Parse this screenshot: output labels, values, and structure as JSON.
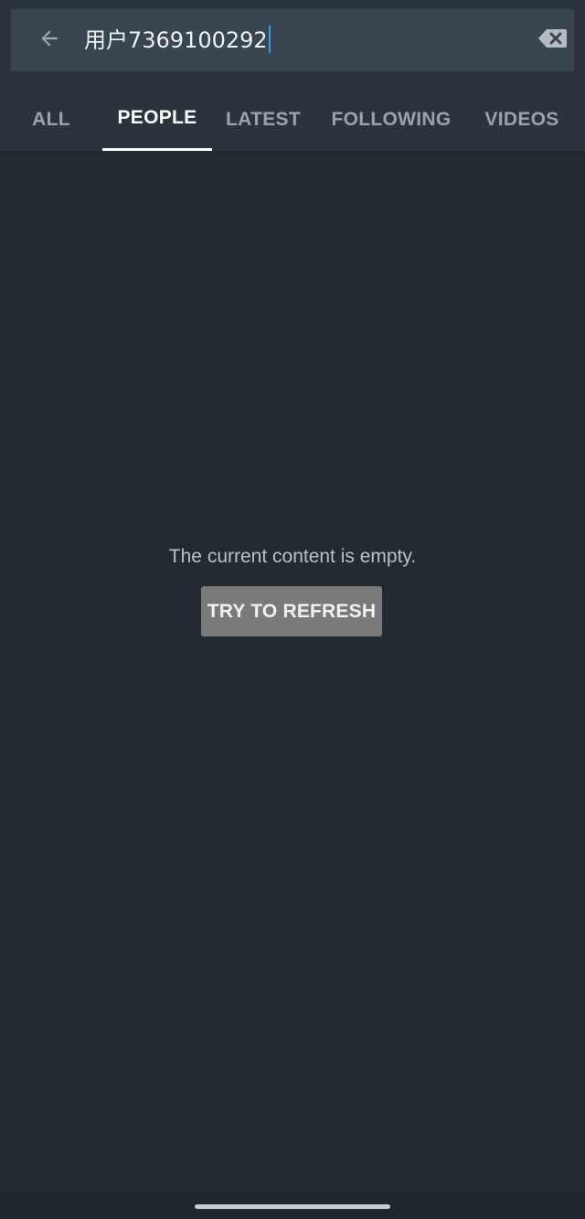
{
  "search": {
    "query": "用户7369100292",
    "back_icon": "arrow-left-icon",
    "clear_icon": "backspace-clear-icon"
  },
  "tabs": [
    {
      "label": "ALL",
      "active": false
    },
    {
      "label": "PEOPLE",
      "active": true
    },
    {
      "label": "LATEST",
      "active": false
    },
    {
      "label": "FOLLOWING",
      "active": false
    },
    {
      "label": "VIDEOS",
      "active": false
    }
  ],
  "empty_state": {
    "message": "The current content is empty.",
    "button_label": "TRY TO REFRESH"
  },
  "colors": {
    "background": "#232a31",
    "header": "#2b343c",
    "search_bg": "#3a464f",
    "caret": "#2ea3e6",
    "button_bg": "#7a7a7a",
    "active_tab": "#ffffff",
    "inactive_tab": "#9aa3ab"
  }
}
